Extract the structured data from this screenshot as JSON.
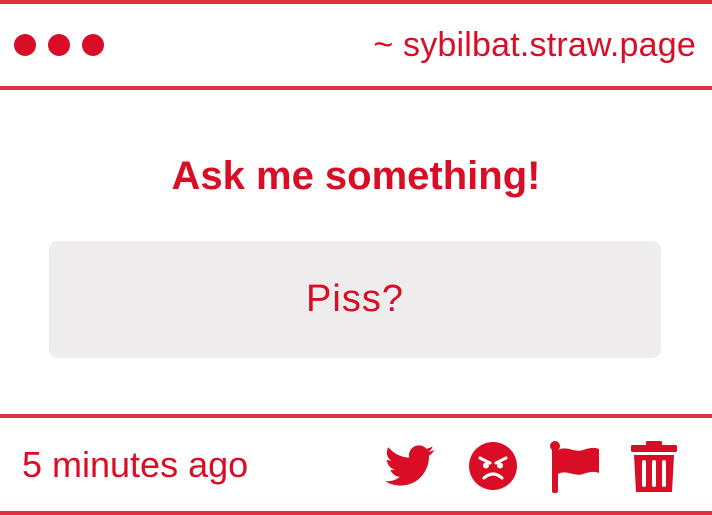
{
  "header": {
    "url": "~ sybilbat.straw.page"
  },
  "main": {
    "heading": "Ask me something!",
    "question": "Piss?"
  },
  "footer": {
    "timestamp": "5 minutes ago",
    "actions": [
      {
        "icon": "twitter-bird-icon",
        "action": "share"
      },
      {
        "icon": "angry-face-icon",
        "action": "react"
      },
      {
        "icon": "flag-icon",
        "action": "report"
      },
      {
        "icon": "trash-icon",
        "action": "delete"
      }
    ]
  },
  "colors": {
    "accent": "#d90d25",
    "rule": "#e0303f",
    "box": "#eeeced",
    "background": "#ffffff"
  }
}
